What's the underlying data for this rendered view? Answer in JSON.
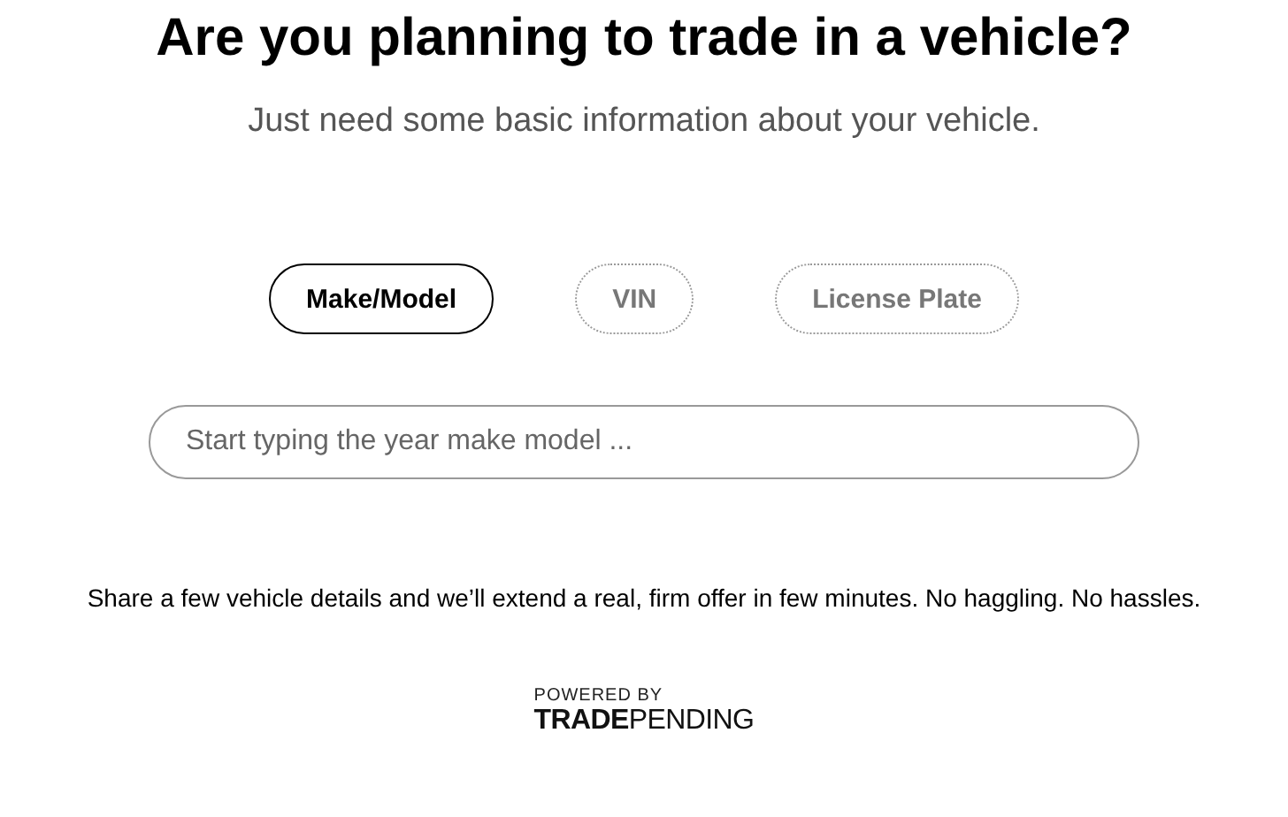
{
  "title": "Are you planning to trade in a vehicle?",
  "subtitle": "Just need some basic information about your vehicle.",
  "tabs": [
    {
      "label": "Make/Model",
      "selected": true
    },
    {
      "label": "VIN",
      "selected": false
    },
    {
      "label": "License Plate",
      "selected": false
    }
  ],
  "search": {
    "placeholder": "Start typing the year make model ..."
  },
  "description": "Share a few vehicle details and we’ll extend a real, firm offer in few minutes. No haggling. No hassles.",
  "powered_by": {
    "caption": "POWERED BY",
    "logo": "**TRADE**PENDING"
  }
}
